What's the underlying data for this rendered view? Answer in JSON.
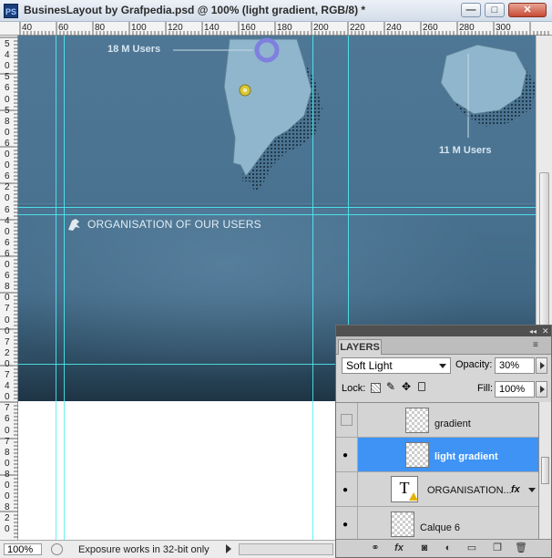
{
  "window": {
    "app_icon": "PS",
    "title": "BusinesLayout by Grafpedia.psd @ 100% (light gradient, RGB/8) *",
    "controls": {
      "minimize": "—",
      "restore": "□",
      "close": "✕"
    }
  },
  "rulers": {
    "top_labels": [
      "40",
      "60",
      "80",
      "100",
      "120",
      "140",
      "160",
      "180",
      "200",
      "220",
      "240",
      "260",
      "280",
      "300"
    ],
    "left_labels": [
      "5",
      "4",
      "0",
      "5",
      "6",
      "0",
      "5",
      "8",
      "0",
      "6",
      "0",
      "0",
      "6",
      "2",
      "0",
      "6",
      "4",
      "0",
      "6",
      "6",
      "0",
      "6",
      "8",
      "0",
      "7",
      "0",
      "0",
      "7",
      "2",
      "0",
      "7",
      "4",
      "0",
      "7",
      "6",
      "0",
      "7",
      "8",
      "0",
      "8",
      "0",
      "0",
      "8",
      "2",
      "0"
    ]
  },
  "canvas": {
    "users_left": "18 M Users",
    "users_right": "11 M Users",
    "section_title": "ORGANISATION OF OUR USERS",
    "colors": {
      "guide": "#4ff0f5",
      "land": "#8fb6cc",
      "ring": "#7f7fe0",
      "pin": "#d8c63a"
    }
  },
  "status": {
    "zoom": "100%",
    "message": "Exposure works in 32-bit only"
  },
  "layers_panel": {
    "tab_label": "LAYERS",
    "blend_mode": "Soft Light",
    "opacity_label": "Opacity:",
    "opacity_value": "30%",
    "lock_label": "Lock:",
    "fill_label": "Fill:",
    "fill_value": "100%",
    "layers": [
      {
        "name": "gradient",
        "visible": false,
        "selected": false,
        "kind": "raster"
      },
      {
        "name": "light gradient",
        "visible": true,
        "selected": true,
        "kind": "raster"
      },
      {
        "name": "ORGANISATION...",
        "visible": true,
        "selected": false,
        "kind": "text",
        "fx": "fx"
      },
      {
        "name": "Calque 6",
        "visible": true,
        "selected": false,
        "kind": "raster"
      }
    ],
    "bottom_icons": [
      "link-icon",
      "fx-icon",
      "mask-icon",
      "adjustment-icon",
      "group-icon",
      "new-layer-icon",
      "trash-icon"
    ]
  }
}
